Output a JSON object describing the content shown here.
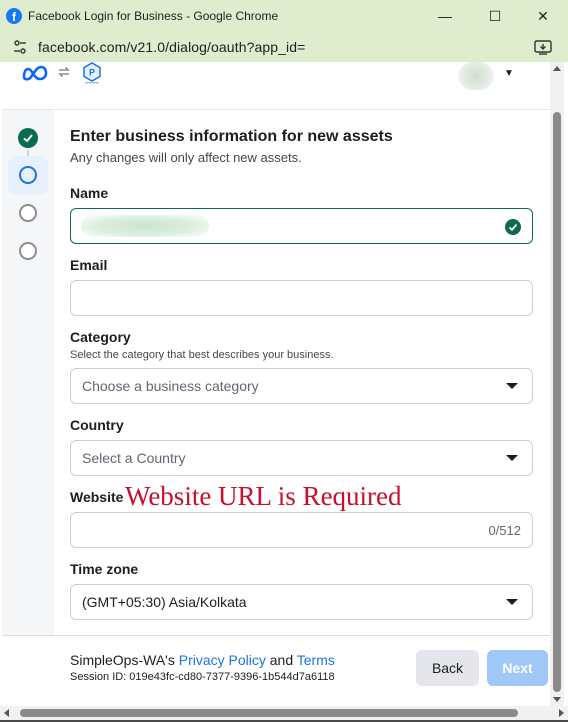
{
  "window": {
    "title": "Facebook Login for Business - Google Chrome",
    "minimize_glyph": "—",
    "maximize_glyph": "☐",
    "close_glyph": "✕",
    "app_icon": "facebook-icon"
  },
  "address_bar": {
    "url": "facebook.com/v21.0/dialog/oauth?app_id=",
    "url_faded": "·",
    "site_info_icon": "tune-icon",
    "install_icon": "install-app-icon"
  },
  "header": {
    "brand_icon": "meta-logo-icon",
    "sync_icon": "sync-icon",
    "app_logo_icon": "app-logo-icon",
    "account_menu_icon": "caret-down-icon",
    "caret_glyph": "▼"
  },
  "steps": [
    {
      "state": "completed",
      "icon": "check-circle-icon"
    },
    {
      "state": "active",
      "icon": "circle-icon"
    },
    {
      "state": "pending",
      "icon": "circle-icon"
    },
    {
      "state": "pending",
      "icon": "circle-icon"
    }
  ],
  "form": {
    "title": "Enter business information for new assets",
    "subtitle": "Any changes will only affect new assets.",
    "name": {
      "label": "Name",
      "value": "",
      "status": "valid"
    },
    "email": {
      "label": "Email",
      "value": ""
    },
    "category": {
      "label": "Category",
      "hint": "Select the category that best describes your business.",
      "placeholder": "Choose a business category"
    },
    "country": {
      "label": "Country",
      "placeholder": "Select a Country"
    },
    "website": {
      "label": "Website",
      "value": "",
      "counter": "0/512"
    },
    "timezone": {
      "label": "Time zone",
      "value": "(GMT+05:30) Asia/Kolkata"
    }
  },
  "annotation": {
    "text": "Website URL is Required",
    "color": "#c8102e"
  },
  "footer": {
    "app_name": "SimpleOps-WA's",
    "privacy_link": "Privacy Policy",
    "and_text": "and",
    "terms_link": "Terms",
    "session_id": "Session ID: 019e43fc-cd80-7377-9396-1b544d7a6118",
    "back_label": "Back",
    "next_label": "Next"
  },
  "colors": {
    "titlebar": "#dfeccd",
    "success": "#0a6b4f",
    "link": "#1b74e4",
    "next_disabled": "#9fc7f8"
  }
}
